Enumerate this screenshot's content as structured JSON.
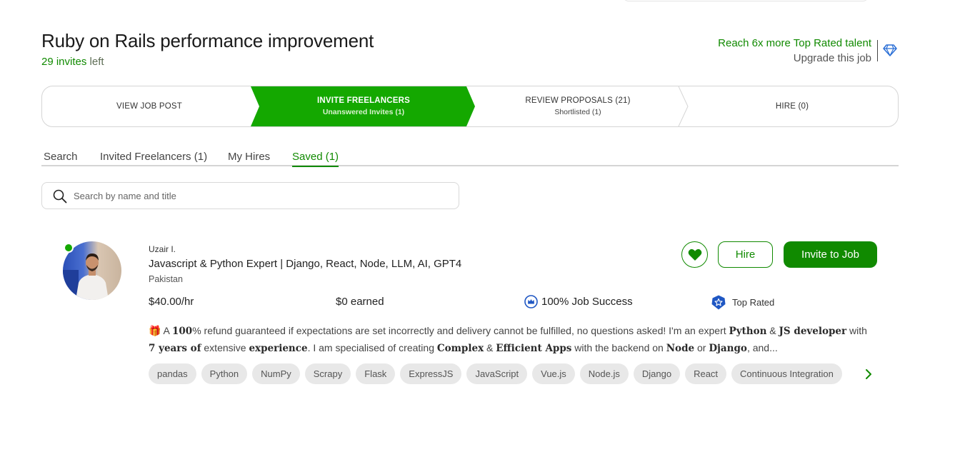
{
  "job": {
    "title": "Ruby on Rails performance improvement",
    "invites_count": "29 invites",
    "invites_suffix": " left"
  },
  "upgrade": {
    "reach_text": "Reach 6x more Top Rated talent",
    "upgrade_text": "Upgrade this job",
    "icon": "diamond-icon"
  },
  "stepper": {
    "steps": [
      {
        "label": "VIEW JOB POST",
        "sub": ""
      },
      {
        "label": "INVITE FREELANCERS",
        "sub": "Unanswered Invites (1)"
      },
      {
        "label": "REVIEW PROPOSALS (21)",
        "sub": "Shortlisted (1)"
      },
      {
        "label": "HIRE (0)",
        "sub": ""
      }
    ],
    "active_index": 1,
    "active_color": "#14a800"
  },
  "tabs": [
    {
      "label": "Search"
    },
    {
      "label": "Invited Freelancers (1)"
    },
    {
      "label": "My Hires"
    },
    {
      "label": "Saved (1)"
    }
  ],
  "search": {
    "placeholder": "Search by name and title",
    "value": ""
  },
  "freelancer": {
    "name": "Uzair I.",
    "title": "Javascript & Python Expert | Django, React, Node, LLM, AI, GPT4",
    "country": "Pakistan",
    "rate": "$40.00/hr",
    "earned": "$0 earned",
    "job_success": "100% Job Success",
    "badge": "Top Rated",
    "online": true,
    "description": {
      "emoji": "🎁",
      "t1": " A ",
      "b1": "100",
      "t2": "% refund guaranteed if expectations are set incorrectly and delivery cannot be fulfilled, no questions asked! I'm an expert ",
      "b2": "Python",
      "t3": " & ",
      "b3": "JS developer",
      "t4": " with ",
      "b4": "7 years of",
      "t5": " extensive ",
      "b5": "experience",
      "t6": ". I am specialised of creating ",
      "b6": "Complex",
      "t7": " & ",
      "b7": "Efficient Apps",
      "t8": " with the backend on ",
      "b8": "Node",
      "t9": " or ",
      "b9": "Django",
      "t10": ", and..."
    },
    "skills": [
      "pandas",
      "Python",
      "NumPy",
      "Scrapy",
      "Flask",
      "ExpressJS",
      "JavaScript",
      "Vue.js",
      "Node.js",
      "Django",
      "React",
      "Continuous Integration"
    ]
  },
  "actions": {
    "hire_label": "Hire",
    "invite_label": "Invite to Job"
  },
  "colors": {
    "brand_green": "#108a00",
    "active_step": "#14a800"
  }
}
